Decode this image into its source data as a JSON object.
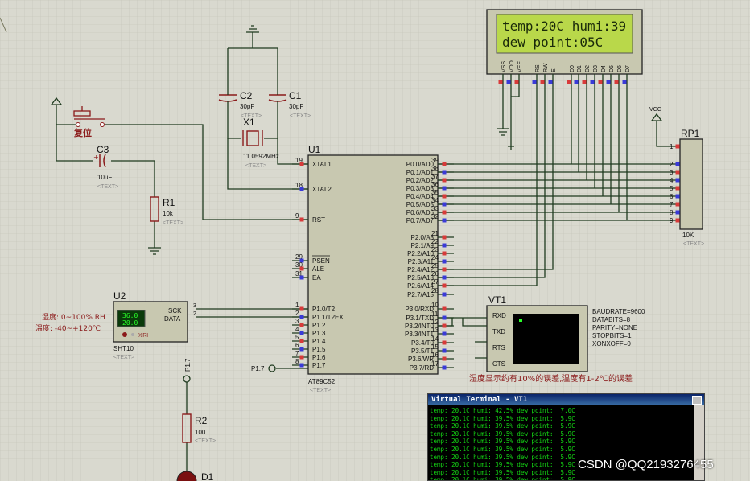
{
  "lcd": {
    "line1": "temp:20C humi:39",
    "line2": "dew point:05C",
    "pins": [
      "VSS",
      "VDD",
      "VEE",
      "RS",
      "RW",
      "E",
      "D0",
      "D1",
      "D2",
      "D3",
      "D4",
      "D5",
      "D6",
      "D7"
    ],
    "pin_nums": [
      "1",
      "2",
      "3",
      "4",
      "5",
      "6",
      "7",
      "8",
      "9",
      "10",
      "11",
      "12",
      "13",
      "14"
    ]
  },
  "u1": {
    "ref": "U1",
    "part": "AT89C52",
    "text": "<TEXT>",
    "left_pins": [
      {
        "num": "19",
        "name": "XTAL1"
      },
      {
        "num": "18",
        "name": "XTAL2"
      },
      {
        "num": "9",
        "name": "RST"
      },
      {
        "num": "29",
        "name": "PSEN"
      },
      {
        "num": "30",
        "name": "ALE"
      },
      {
        "num": "31",
        "name": "EA"
      },
      {
        "num": "1",
        "name": "P1.0/T2"
      },
      {
        "num": "2",
        "name": "P1.1/T2EX"
      },
      {
        "num": "3",
        "name": "P1.2"
      },
      {
        "num": "4",
        "name": "P1.3"
      },
      {
        "num": "5",
        "name": "P1.4"
      },
      {
        "num": "6",
        "name": "P1.5"
      },
      {
        "num": "7",
        "name": "P1.6"
      },
      {
        "num": "8",
        "name": "P1.7"
      }
    ],
    "right_pins": [
      {
        "num": "39",
        "name": "P0.0/AD0"
      },
      {
        "num": "38",
        "name": "P0.1/AD1"
      },
      {
        "num": "37",
        "name": "P0.2/AD2"
      },
      {
        "num": "36",
        "name": "P0.3/AD3"
      },
      {
        "num": "35",
        "name": "P0.4/AD4"
      },
      {
        "num": "34",
        "name": "P0.5/AD5"
      },
      {
        "num": "33",
        "name": "P0.6/AD6"
      },
      {
        "num": "32",
        "name": "P0.7/AD7"
      },
      {
        "num": "21",
        "name": "P2.0/A8"
      },
      {
        "num": "22",
        "name": "P2.1/A9"
      },
      {
        "num": "23",
        "name": "P2.2/A10"
      },
      {
        "num": "24",
        "name": "P2.3/A11"
      },
      {
        "num": "25",
        "name": "P2.4/A12"
      },
      {
        "num": "26",
        "name": "P2.5/A13"
      },
      {
        "num": "27",
        "name": "P2.6/A14"
      },
      {
        "num": "28",
        "name": "P2.7/A15"
      },
      {
        "num": "10",
        "name": "P3.0/RXD"
      },
      {
        "num": "11",
        "name": "P3.1/TXD"
      },
      {
        "num": "12",
        "name": "P3.2/INT0"
      },
      {
        "num": "13",
        "name": "P3.3/INT1"
      },
      {
        "num": "14",
        "name": "P3.4/T0"
      },
      {
        "num": "15",
        "name": "P3.5/T1"
      },
      {
        "num": "16",
        "name": "P3.6/WR"
      },
      {
        "num": "17",
        "name": "P3.7/RD"
      }
    ]
  },
  "c1": {
    "ref": "C1",
    "val": "30pF",
    "text": "<TEXT>"
  },
  "c2": {
    "ref": "C2",
    "val": "30pF",
    "text": "<TEXT>"
  },
  "x1": {
    "ref": "X1",
    "val": "11.0592MHz",
    "text": "<TEXT>"
  },
  "c3": {
    "ref": "C3",
    "val": "10uF",
    "text": "<TEXT>"
  },
  "r1": {
    "ref": "R1",
    "val": "10k",
    "text": "<TEXT>"
  },
  "r2": {
    "ref": "R2",
    "val": "100",
    "text": "<TEXT>"
  },
  "d1": {
    "ref": "D1"
  },
  "reset": {
    "label": "复位"
  },
  "rp1": {
    "ref": "RP1",
    "val": "10K",
    "text": "<TEXT>",
    "vcc": "VCC",
    "pins": [
      "1",
      "2",
      "3",
      "4",
      "5",
      "6",
      "7",
      "8",
      "9"
    ]
  },
  "u2": {
    "ref": "U2",
    "part": "SHT10",
    "text": "<TEXT>",
    "sck": "SCK",
    "data": "DATA",
    "temp": "36.0",
    "humi": "20.0",
    "unit": "%RH",
    "pin3": "3",
    "pin2": "2",
    "note1": "湿度: 0~100% RH",
    "note2": "温度: -40~+120℃"
  },
  "p17": {
    "label": "P1.7",
    "net": "P1.7"
  },
  "vt1": {
    "ref": "VT1",
    "rxd": "RXD",
    "txd": "TXD",
    "rts": "RTS",
    "cts": "CTS",
    "cfg": [
      "BAUDRATE=9600",
      "DATABITS=8",
      "PARITY=NONE",
      "STOPBITS=1",
      "XONXOFF=0"
    ]
  },
  "note": "湿度显示约有10%的误差,温度有1-2℃的误差",
  "terminal": {
    "title": "Virtual Terminal - VT1",
    "lines": [
      "temp: 20.1C humi: 42.5% dew point:  7.0C",
      "temp: 20.1C humi: 39.5% dew point:  5.9C",
      "temp: 20.1C humi: 39.5% dew point:  5.9C",
      "temp: 20.1C humi: 39.5% dew point:  5.9C",
      "temp: 20.1C humi: 39.5% dew point:  5.9C",
      "temp: 20.1C humi: 39.5% dew point:  5.9C",
      "temp: 20.1C humi: 39.5% dew point:  5.9C",
      "temp: 20.1C humi: 39.5% dew point:  5.9C",
      "temp: 20.1C humi: 39.5% dew point:  5.9C",
      "temp: 20.1C humi: 39.5% dew point:  5.9C"
    ]
  },
  "watermark": "CSDN @QQ2193276455"
}
